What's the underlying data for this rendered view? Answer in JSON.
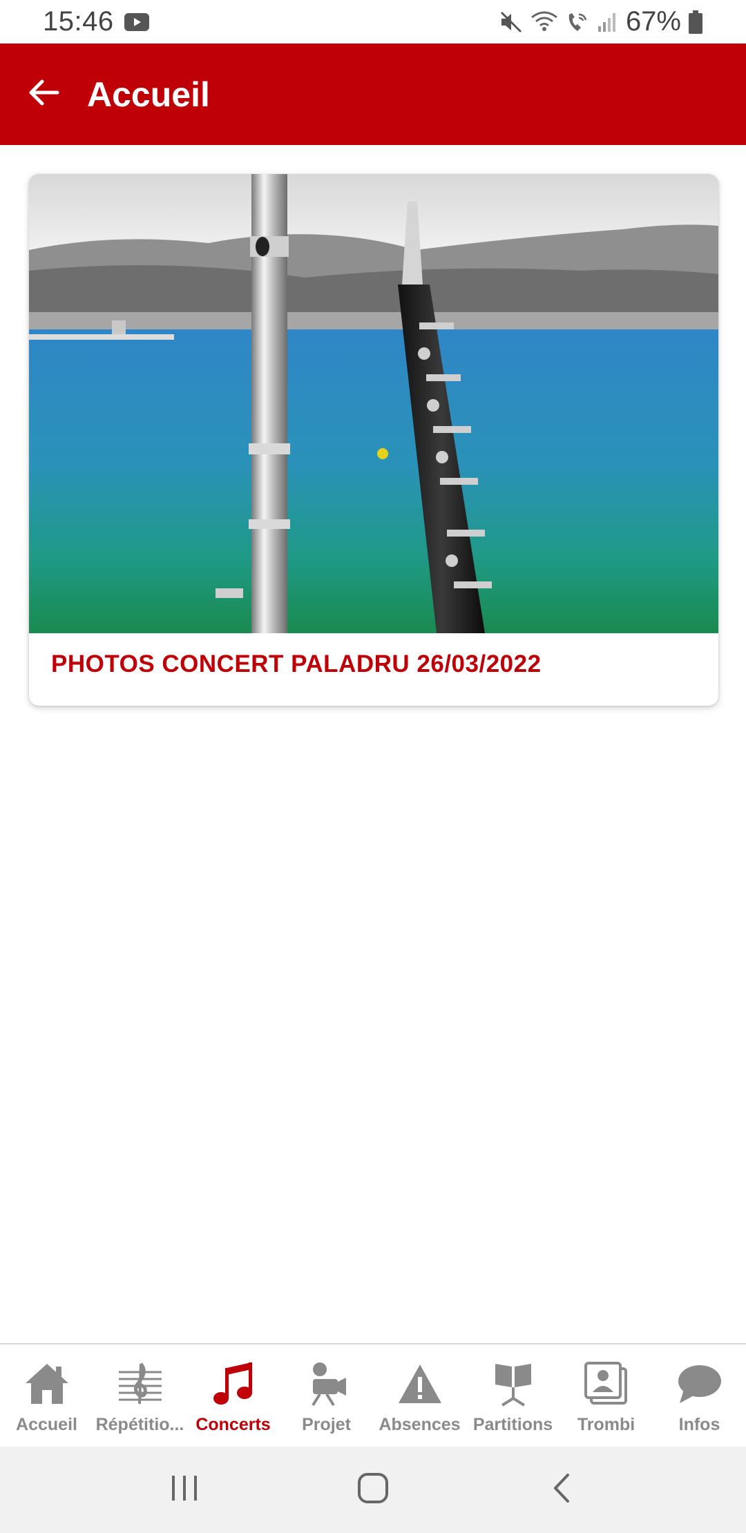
{
  "status_bar": {
    "time": "15:46",
    "battery": "67%",
    "icons": [
      "youtube-icon",
      "mute-icon",
      "wifi-icon",
      "wifi-call-icon",
      "signal-icon",
      "battery-icon"
    ]
  },
  "app_bar": {
    "title": "Accueil",
    "back_icon": "arrow-left-icon"
  },
  "feed": {
    "cards": [
      {
        "title": "PHOTOS CONCERT PALADRU 26/03/2022"
      }
    ]
  },
  "bottom_nav": {
    "items": [
      {
        "label": "Accueil",
        "icon": "home-icon",
        "active": false
      },
      {
        "label": "Répétitio...",
        "icon": "music-staff-icon",
        "active": false
      },
      {
        "label": "Concerts",
        "icon": "music-note-icon",
        "active": true
      },
      {
        "label": "Projet",
        "icon": "camera-person-icon",
        "active": false
      },
      {
        "label": "Absences",
        "icon": "warning-icon",
        "active": false
      },
      {
        "label": "Partitions",
        "icon": "music-stand-icon",
        "active": false
      },
      {
        "label": "Trombi",
        "icon": "portrait-icon",
        "active": false
      },
      {
        "label": "Infos",
        "icon": "chat-bubble-icon",
        "active": false
      }
    ]
  },
  "colors": {
    "primary": "#bf0007",
    "inactive": "#8a8a8a"
  }
}
